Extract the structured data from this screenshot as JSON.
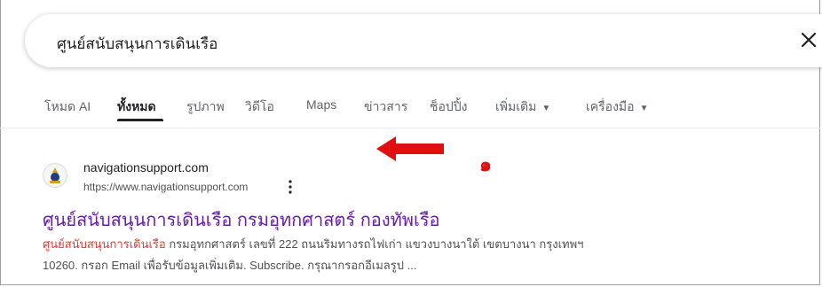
{
  "search": {
    "query": "ศูนย์สนับสนุนการเดินเรือ",
    "clear_icon": "close-icon"
  },
  "tabs": [
    {
      "label": "โหมด AI",
      "active": false
    },
    {
      "label": "ทั้งหมด",
      "active": true
    },
    {
      "label": "รูปภาพ",
      "active": false
    },
    {
      "label": "วิดีโอ",
      "active": false
    },
    {
      "label": "Maps",
      "active": false
    },
    {
      "label": "ข่าวสาร",
      "active": false
    },
    {
      "label": "ช็อปปิ้ง",
      "active": false
    },
    {
      "label": "เพิ่มเติม",
      "active": false,
      "dropdown": true
    },
    {
      "label": "เครื่องมือ",
      "active": false,
      "dropdown": true
    }
  ],
  "annotation": {
    "number": "๑",
    "arrow_color": "#e01010"
  },
  "result": {
    "site_name": "navigationsupport.com",
    "url": "https://www.navigationsupport.com",
    "title": "ศูนย์สนับสนุนการเดินเรือ กรมอุทกศาสตร์ กองทัพเรือ",
    "snippet_highlight": "ศูนย์สนับสนุนการเดินเรือ",
    "snippet_line1_rest": " กรมอุทกศาสตร์ เลขที่ 222 ถนนริมทางรถไฟเก่า แขวงบางนาใต้ เขตบางนา กรุงเทพฯ",
    "snippet_line2": "10260. กรอก Email เพื่อรับข้อมูลเพิ่มเติม. Subscribe. กรุณากรอกอีเมลรูป ..."
  },
  "colors": {
    "title_link": "#681da8",
    "highlight": "#e53935",
    "annotation_red": "#e01010"
  }
}
